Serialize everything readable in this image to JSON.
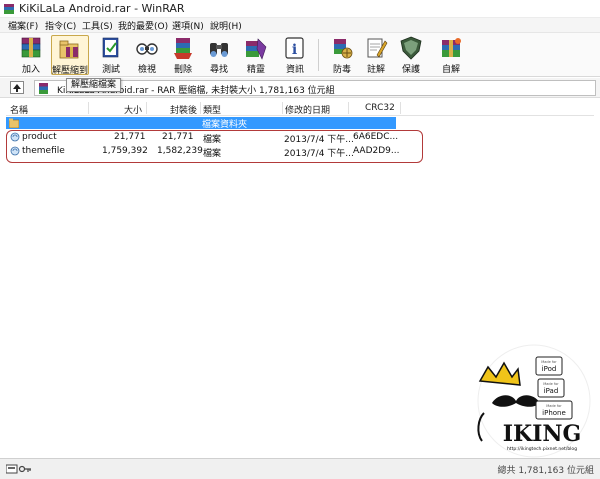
{
  "window": {
    "title": "KiKiLaLa Android.rar - WinRAR"
  },
  "menu": [
    {
      "label": "檔案(F)"
    },
    {
      "label": "指令(C)"
    },
    {
      "label": "工具(S)"
    },
    {
      "label": "我的最愛(O)"
    },
    {
      "label": "選項(N)"
    },
    {
      "label": "說明(H)"
    }
  ],
  "toolbar": {
    "items": [
      {
        "label": "加入",
        "icon": "add-archive-icon"
      },
      {
        "label": "解壓縮到",
        "icon": "extract-to-icon"
      },
      {
        "label": "測試",
        "icon": "test-icon"
      },
      {
        "label": "檢視",
        "icon": "view-icon"
      },
      {
        "label": "刪除",
        "icon": "delete-icon"
      },
      {
        "label": "尋找",
        "icon": "find-icon"
      },
      {
        "label": "精靈",
        "icon": "wizard-icon"
      },
      {
        "label": "資訊",
        "icon": "info-icon"
      },
      {
        "label": "防毒",
        "icon": "virus-scan-icon"
      },
      {
        "label": "註解",
        "icon": "comment-icon"
      },
      {
        "label": "保護",
        "icon": "protect-icon"
      },
      {
        "label": "自解",
        "icon": "sfx-icon"
      }
    ],
    "tooltip": "解壓縮檔案"
  },
  "path": {
    "text": "KiKiLaLa Android.rar - RAR 壓縮檔, 未封裝大小 1,781,163 位元組"
  },
  "columns": {
    "name": "名稱",
    "size": "大小",
    "packed": "封裝後",
    "type": "類型",
    "modified": "修改的日期",
    "crc": "CRC32"
  },
  "parent_row": {
    "type": "檔案資料夾"
  },
  "files": [
    {
      "name": "product",
      "size": "21,771",
      "packed": "21,771",
      "type": "檔案",
      "modified": "2013/7/4 下午...",
      "crc": "6A6EDC..."
    },
    {
      "name": "themefile",
      "size": "1,759,392",
      "packed": "1,582,239",
      "type": "檔案",
      "modified": "2013/7/4 下午...",
      "crc": "AAD2D9..."
    }
  ],
  "status": {
    "text": "總共 1,781,163 位元組"
  },
  "logo": {
    "brand": "IKING",
    "url": "http://ikingtech.pixnet.net/blog",
    "badges": [
      "iPod",
      "iPad",
      "iPhone"
    ],
    "badge_prefix": "Made for"
  },
  "colors": {
    "selection": "#3399ff",
    "highlight": "#b23a3a"
  }
}
